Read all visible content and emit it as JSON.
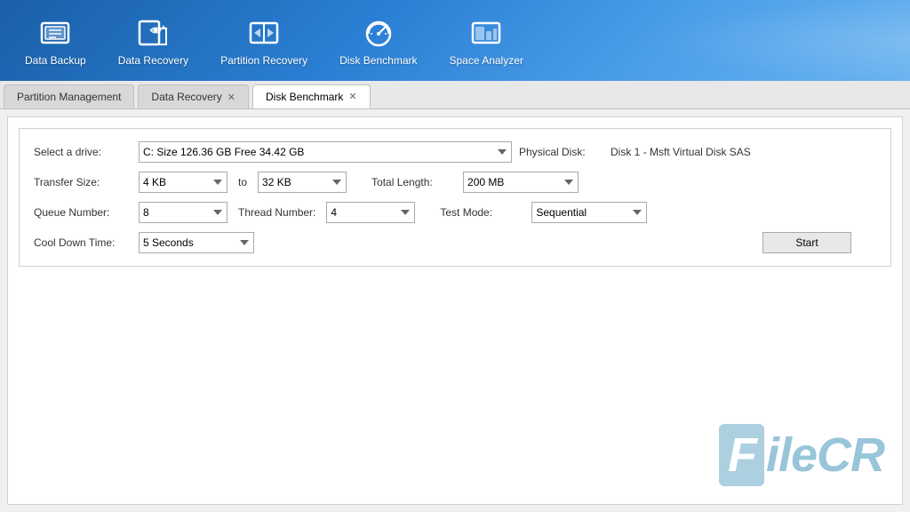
{
  "toolbar": {
    "items": [
      {
        "id": "data-backup",
        "label": "Data Backup",
        "icon": "backup-icon"
      },
      {
        "id": "data-recovery",
        "label": "Data Recovery",
        "icon": "recovery-icon"
      },
      {
        "id": "partition-recovery",
        "label": "Partition Recovery",
        "icon": "partition-icon"
      },
      {
        "id": "disk-benchmark",
        "label": "Disk Benchmark",
        "icon": "benchmark-icon"
      },
      {
        "id": "space-analyzer",
        "label": "Space Analyzer",
        "icon": "space-icon"
      }
    ]
  },
  "tabs": [
    {
      "id": "partition-management",
      "label": "Partition Management",
      "closable": false,
      "active": false
    },
    {
      "id": "data-recovery",
      "label": "Data Recovery",
      "closable": true,
      "active": false
    },
    {
      "id": "disk-benchmark",
      "label": "Disk Benchmark",
      "closable": true,
      "active": true
    }
  ],
  "form": {
    "select_drive_label": "Select a drive:",
    "drive_value": "C:  Size 126.36 GB  Free 34.42 GB",
    "physical_disk_label": "Physical Disk:",
    "physical_disk_value": "Disk 1 - Msft Virtual Disk SAS",
    "transfer_size_label": "Transfer Size:",
    "transfer_size_from": "4 KB",
    "transfer_size_to_label": "to",
    "transfer_size_to": "32 KB",
    "total_length_label": "Total Length:",
    "total_length_value": "200 MB",
    "queue_number_label": "Queue Number:",
    "queue_number_value": "8",
    "thread_number_label": "Thread Number:",
    "thread_number_value": "4",
    "test_mode_label": "Test Mode:",
    "test_mode_value": "Sequential",
    "cool_down_label": "Cool Down Time:",
    "cool_down_value": "5 Seconds",
    "start_button": "Start"
  },
  "watermark": {
    "box_text": "F",
    "rest_text": "ileCR"
  }
}
